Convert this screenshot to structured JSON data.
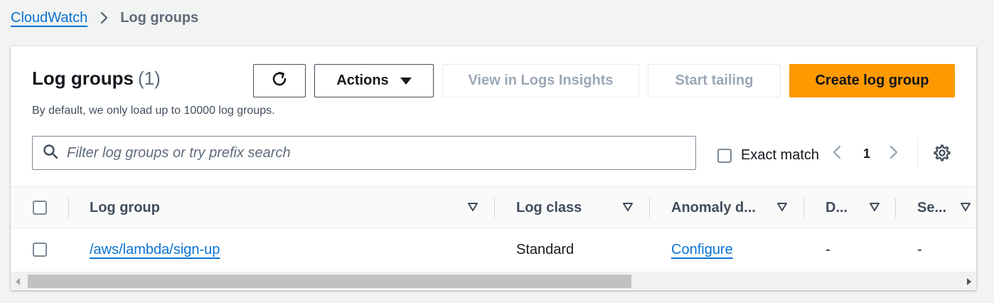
{
  "breadcrumb": {
    "root": "CloudWatch",
    "current": "Log groups"
  },
  "panel": {
    "title": "Log groups",
    "count": "(1)",
    "description": "By default, we only load up to 10000 log groups."
  },
  "toolbar": {
    "refresh_icon": "refresh-icon",
    "actions_label": "Actions",
    "insights_label": "View in Logs Insights",
    "tailing_label": "Start tailing",
    "create_label": "Create log group"
  },
  "search": {
    "placeholder": "Filter log groups or try prefix search",
    "value": ""
  },
  "exact_match": {
    "label": "Exact match",
    "checked": false
  },
  "pagination": {
    "current_page": "1"
  },
  "table": {
    "columns": [
      "Log group",
      "Log class",
      "Anomaly d...",
      "D...",
      "Se..."
    ],
    "rows": [
      {
        "log_group": "/aws/lambda/sign-up",
        "log_class": "Standard",
        "anomaly": "Configure",
        "d": "-",
        "se": "-"
      }
    ]
  },
  "colors": {
    "link": "#0972d3",
    "primary": "#ff9900",
    "disabled_text": "#9ba7b6",
    "background": "#f2f3f3"
  }
}
